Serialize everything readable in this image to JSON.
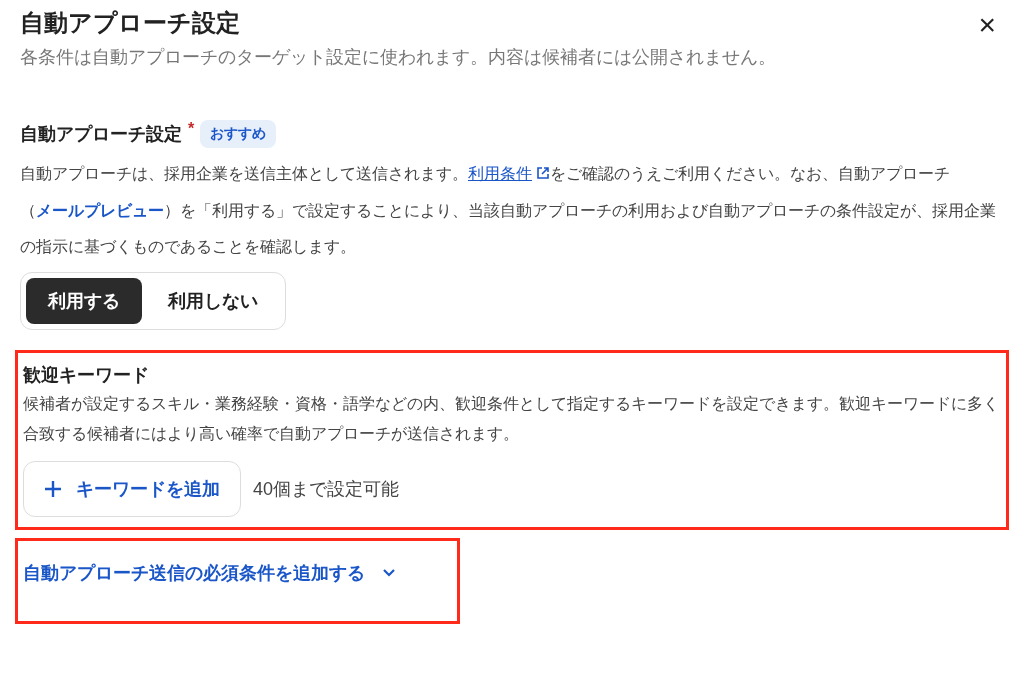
{
  "dialog": {
    "title": "自動アプローチ設定",
    "subtitle": "各条件は自動アプローチのターゲット設定に使われます。内容は候補者には公開されません。",
    "close": "×"
  },
  "auto_approach": {
    "label": "自動アプローチ設定",
    "required_mark": "*",
    "badge": "おすすめ",
    "description": [
      {
        "kind": "text",
        "text": "自動アプローチは、採用企業を送信主体として送信されます。"
      },
      {
        "kind": "external_link",
        "text": "利用条件"
      },
      {
        "kind": "text",
        "text": "をご確認のうえご利用ください。なお、自動アプローチ（"
      },
      {
        "kind": "bold_link",
        "text": "メールプレビュー"
      },
      {
        "kind": "text",
        "text": "）を「利用する」で設定することにより、当該自動アプローチの利用および自動アプローチの条件設定が、採用企業の指示に基づくものであることを確認します。"
      }
    ],
    "options": [
      {
        "label": "利用する",
        "selected": true
      },
      {
        "label": "利用しない",
        "selected": false
      }
    ]
  },
  "keywords": {
    "highlighted": true,
    "title": "歓迎キーワード",
    "description": "候補者が設定するスキル・業務経験・資格・語学などの内、歓迎条件として指定するキーワードを設定できます。歓迎キーワードに多く合致する候補者にはより高い確率で自動アプローチが送信されます。",
    "add_button": "キーワードを追加",
    "limit_note": "40個まで設定可能"
  },
  "required_conditions": {
    "highlighted": true,
    "label": "自動アプローチ送信の必須条件を追加する",
    "expanded": false
  }
}
